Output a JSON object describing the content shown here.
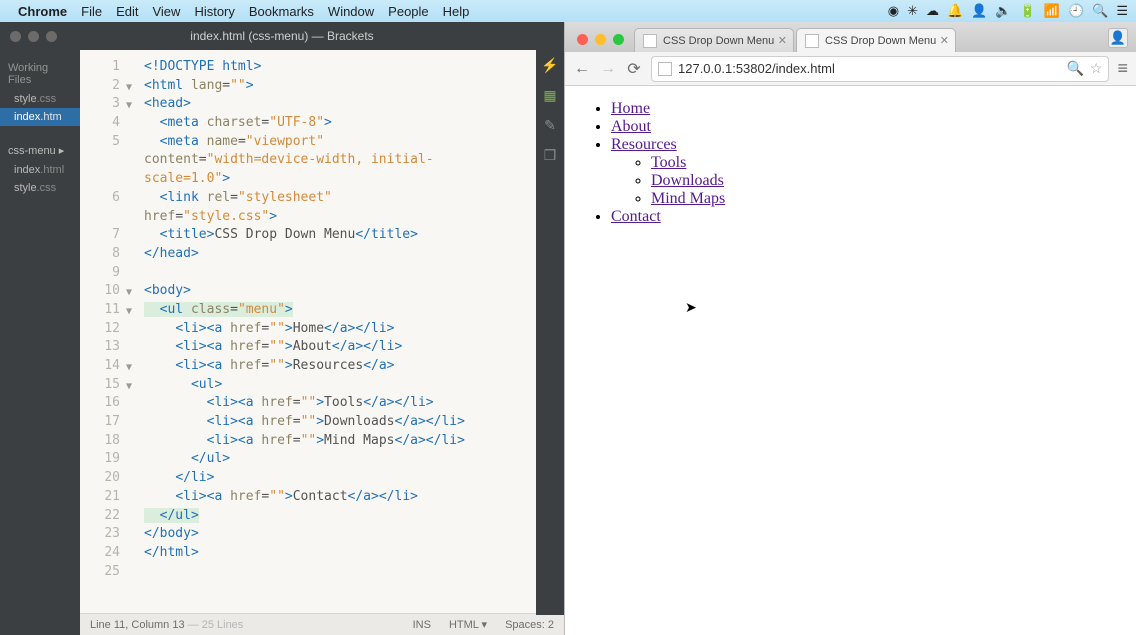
{
  "mac_menu": {
    "app": "Chrome",
    "items": [
      "File",
      "Edit",
      "View",
      "History",
      "Bookmarks",
      "Window",
      "People",
      "Help"
    ],
    "right_icons": [
      "circled-dot-icon",
      "asterisk-icon",
      "cloud-icon",
      "bell-icon",
      "user-icon",
      "speaker-icon",
      "divider",
      "battery-icon",
      "wifi-icon",
      "clock-icon",
      "search-icon",
      "list-icon"
    ]
  },
  "brackets": {
    "title": "index.html (css-menu) — Brackets",
    "sidebar": {
      "working_label": "Working Files",
      "working": [
        {
          "name": "style",
          "ext": ".css",
          "selected": false
        },
        {
          "name": "index",
          "ext": ".htm",
          "selected": true
        }
      ],
      "folder": "css-menu ▸",
      "project": [
        {
          "name": "index",
          "ext": ".html"
        },
        {
          "name": "style",
          "ext": ".css"
        }
      ]
    },
    "tools": [
      "bolt-icon",
      "extensions-icon",
      "code-icon",
      "cube-icon"
    ],
    "code_lines": [
      {
        "n": 1,
        "seg": [
          [
            "tag",
            "<!DOCTYPE html>"
          ]
        ]
      },
      {
        "n": 2,
        "fold": true,
        "seg": [
          [
            "tag",
            "<html "
          ],
          [
            "attr",
            "lang"
          ],
          [
            "punc",
            "="
          ],
          [
            "val",
            "\"\""
          ],
          [
            "tag",
            ">"
          ]
        ]
      },
      {
        "n": 3,
        "fold": true,
        "seg": [
          [
            "tag",
            "<head>"
          ]
        ]
      },
      {
        "n": 4,
        "seg": [
          [
            "punc",
            "  "
          ],
          [
            "tag",
            "<meta "
          ],
          [
            "attr",
            "charset"
          ],
          [
            "punc",
            "="
          ],
          [
            "val",
            "\"UTF-8\""
          ],
          [
            "tag",
            ">"
          ]
        ]
      },
      {
        "n": 5,
        "seg": [
          [
            "punc",
            "  "
          ],
          [
            "tag",
            "<meta "
          ],
          [
            "attr",
            "name"
          ],
          [
            "punc",
            "="
          ],
          [
            "val",
            "\"viewport\""
          ]
        ]
      },
      {
        "n": "",
        "seg": [
          [
            "attr",
            "content"
          ],
          [
            "punc",
            "="
          ],
          [
            "val",
            "\"width=device-width, initial-"
          ]
        ]
      },
      {
        "n": "",
        "seg": [
          [
            "val",
            "scale=1.0\""
          ],
          [
            "tag",
            ">"
          ]
        ]
      },
      {
        "n": 6,
        "seg": [
          [
            "punc",
            "  "
          ],
          [
            "tag",
            "<link "
          ],
          [
            "attr",
            "rel"
          ],
          [
            "punc",
            "="
          ],
          [
            "val",
            "\"stylesheet\""
          ]
        ]
      },
      {
        "n": "",
        "seg": [
          [
            "attr",
            "href"
          ],
          [
            "punc",
            "="
          ],
          [
            "val",
            "\"style.css\""
          ],
          [
            "tag",
            ">"
          ]
        ]
      },
      {
        "n": 7,
        "seg": [
          [
            "punc",
            "  "
          ],
          [
            "tag",
            "<title>"
          ],
          [
            "text",
            "CSS Drop Down Menu"
          ],
          [
            "tag",
            "</title>"
          ]
        ]
      },
      {
        "n": 8,
        "seg": [
          [
            "tag",
            "</head>"
          ]
        ]
      },
      {
        "n": 9,
        "seg": []
      },
      {
        "n": 10,
        "fold": true,
        "seg": [
          [
            "tag",
            "<body>"
          ]
        ]
      },
      {
        "n": 11,
        "fold": true,
        "hl": true,
        "seg": [
          [
            "punc",
            "  "
          ],
          [
            "hltag",
            "<ul "
          ],
          [
            "hlattr",
            "class"
          ],
          [
            "hlpunc",
            "="
          ],
          [
            "hlval",
            "\"menu\""
          ],
          [
            "hltag",
            ">"
          ]
        ]
      },
      {
        "n": 12,
        "seg": [
          [
            "punc",
            "    "
          ],
          [
            "tag",
            "<li><a "
          ],
          [
            "attr",
            "href"
          ],
          [
            "punc",
            "="
          ],
          [
            "val",
            "\"\""
          ],
          [
            "tag",
            ">"
          ],
          [
            "text",
            "Home"
          ],
          [
            "tag",
            "</a></li>"
          ]
        ]
      },
      {
        "n": 13,
        "seg": [
          [
            "punc",
            "    "
          ],
          [
            "tag",
            "<li><a "
          ],
          [
            "attr",
            "href"
          ],
          [
            "punc",
            "="
          ],
          [
            "val",
            "\"\""
          ],
          [
            "tag",
            ">"
          ],
          [
            "text",
            "About"
          ],
          [
            "tag",
            "</a></li>"
          ]
        ]
      },
      {
        "n": 14,
        "fold": true,
        "seg": [
          [
            "punc",
            "    "
          ],
          [
            "tag",
            "<li><a "
          ],
          [
            "attr",
            "href"
          ],
          [
            "punc",
            "="
          ],
          [
            "val",
            "\"\""
          ],
          [
            "tag",
            ">"
          ],
          [
            "text",
            "Resources"
          ],
          [
            "tag",
            "</a>"
          ]
        ]
      },
      {
        "n": 15,
        "fold": true,
        "seg": [
          [
            "punc",
            "      "
          ],
          [
            "tag",
            "<ul>"
          ]
        ]
      },
      {
        "n": 16,
        "seg": [
          [
            "punc",
            "        "
          ],
          [
            "tag",
            "<li><a "
          ],
          [
            "attr",
            "href"
          ],
          [
            "punc",
            "="
          ],
          [
            "val",
            "\"\""
          ],
          [
            "tag",
            ">"
          ],
          [
            "text",
            "Tools"
          ],
          [
            "tag",
            "</a></li>"
          ]
        ]
      },
      {
        "n": 17,
        "seg": [
          [
            "punc",
            "        "
          ],
          [
            "tag",
            "<li><a "
          ],
          [
            "attr",
            "href"
          ],
          [
            "punc",
            "="
          ],
          [
            "val",
            "\"\""
          ],
          [
            "tag",
            ">"
          ],
          [
            "text",
            "Downloads"
          ],
          [
            "tag",
            "</a></li>"
          ]
        ]
      },
      {
        "n": 18,
        "seg": [
          [
            "punc",
            "        "
          ],
          [
            "tag",
            "<li><a "
          ],
          [
            "attr",
            "href"
          ],
          [
            "punc",
            "="
          ],
          [
            "val",
            "\"\""
          ],
          [
            "tag",
            ">"
          ],
          [
            "text",
            "Mind Maps"
          ],
          [
            "tag",
            "</a></li>"
          ]
        ]
      },
      {
        "n": 19,
        "seg": [
          [
            "punc",
            "      "
          ],
          [
            "tag",
            "</ul>"
          ]
        ]
      },
      {
        "n": 20,
        "seg": [
          [
            "punc",
            "    "
          ],
          [
            "tag",
            "</li>"
          ]
        ]
      },
      {
        "n": 21,
        "seg": [
          [
            "punc",
            "    "
          ],
          [
            "tag",
            "<li><a "
          ],
          [
            "attr",
            "href"
          ],
          [
            "punc",
            "="
          ],
          [
            "val",
            "\"\""
          ],
          [
            "tag",
            ">"
          ],
          [
            "text",
            "Contact"
          ],
          [
            "tag",
            "</a></li>"
          ]
        ]
      },
      {
        "n": 22,
        "hl": true,
        "seg": [
          [
            "punc",
            "  "
          ],
          [
            "hltag",
            "</ul>"
          ]
        ]
      },
      {
        "n": 23,
        "seg": [
          [
            "tag",
            "</body>"
          ]
        ]
      },
      {
        "n": 24,
        "seg": [
          [
            "tag",
            "</html>"
          ]
        ]
      },
      {
        "n": 25,
        "seg": []
      }
    ],
    "status": {
      "pos": "Line 11, Column 13",
      "lines": "— 25 Lines",
      "ins": "INS",
      "lang": "HTML ▾",
      "spaces": "Spaces: 2"
    }
  },
  "chrome": {
    "tabs": [
      {
        "title": "CSS Drop Down Menu",
        "active": false
      },
      {
        "title": "CSS Drop Down Menu",
        "active": true
      }
    ],
    "url": "127.0.0.1:53802/index.html",
    "page_links": {
      "home": "Home",
      "about": "About",
      "resources": "Resources",
      "tools": "Tools",
      "downloads": "Downloads",
      "mindmaps": "Mind Maps",
      "contact": "Contact"
    }
  }
}
